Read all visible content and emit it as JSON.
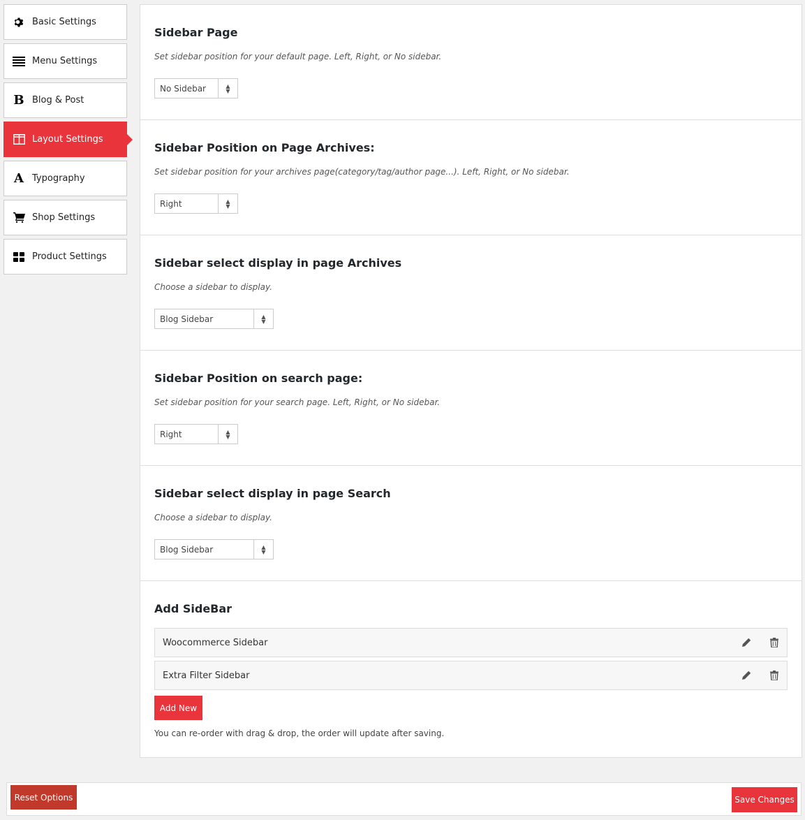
{
  "nav": {
    "items": [
      {
        "label": "Basic Settings",
        "icon": "gear-icon"
      },
      {
        "label": "Menu Settings",
        "icon": "menu-lines-icon"
      },
      {
        "label": "Blog & Post",
        "icon": "bold-b-icon"
      },
      {
        "label": "Layout Settings",
        "icon": "layout-columns-icon",
        "active": true
      },
      {
        "label": "Typography",
        "icon": "letter-a-icon"
      },
      {
        "label": "Shop Settings",
        "icon": "cart-icon"
      },
      {
        "label": "Product Settings",
        "icon": "grid-icon"
      }
    ]
  },
  "sections": [
    {
      "title": "Sidebar Page",
      "desc": "Set sidebar position for your default page. Left, Right, or No sidebar.",
      "value": "No Sidebar"
    },
    {
      "title": "Sidebar Position on Page Archives:",
      "desc": "Set sidebar position for your archives page(category/tag/author page...). Left, Right, or No sidebar.",
      "value": "Right"
    },
    {
      "title": "Sidebar select display in page Archives",
      "desc": "Choose a sidebar to display.",
      "value": "Blog Sidebar"
    },
    {
      "title": "Sidebar Position on search page:",
      "desc": "Set sidebar position for your search page. Left, Right, or No sidebar.",
      "value": "Right"
    },
    {
      "title": "Sidebar select display in page Search",
      "desc": "Choose a sidebar to display.",
      "value": "Blog Sidebar"
    }
  ],
  "add_sidebar": {
    "title": "Add SideBar",
    "items": [
      "Woocommerce Sidebar",
      "Extra Filter Sidebar"
    ],
    "add_label": "Add New",
    "note": "You can re-order with drag & drop, the order will update after saving."
  },
  "footer": {
    "reset_label": "Reset Options",
    "save_label": "Save Changes"
  },
  "colors": {
    "accent": "#e8343a",
    "reset": "#c0392b"
  }
}
